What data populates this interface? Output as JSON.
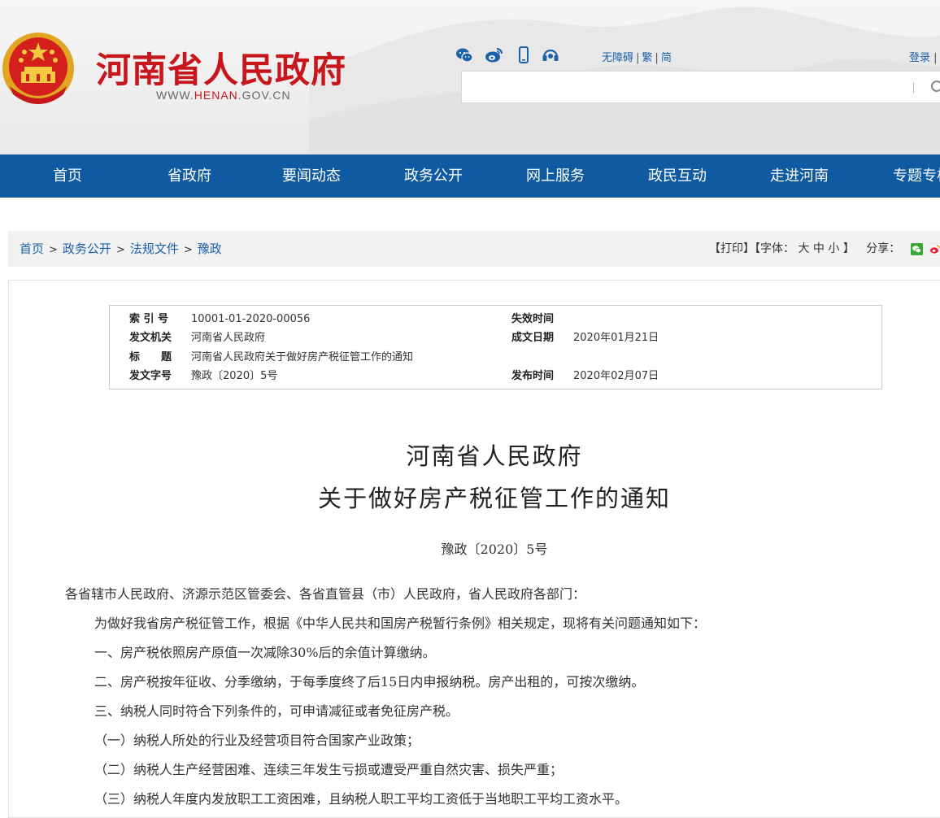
{
  "header": {
    "site_title": "河南省人民政府",
    "site_url_prefix": "WWW.",
    "site_url_highlight": "HENAN",
    "site_url_suffix": ".GOV.CN",
    "accessibility": "无障碍",
    "traditional": "繁",
    "simplified": "简",
    "login": "登录",
    "login_sep": "|",
    "search_placeholder": "",
    "icons": [
      "wechat-icon",
      "weibo-icon",
      "mobile-icon",
      "headset-icon"
    ],
    "brand_red": "#c8161d",
    "link_blue": "#1d61a8"
  },
  "nav": {
    "color": "#0f5aa0",
    "items": [
      "首页",
      "省政府",
      "要闻动态",
      "政务公开",
      "网上服务",
      "政民互动",
      "走进河南",
      "专题专栏"
    ]
  },
  "breadcrumb": {
    "items": [
      "首页",
      "政务公开",
      "法规文件",
      "豫政"
    ],
    "separator": ">"
  },
  "tools": {
    "print": "【打印】",
    "font_prefix": "【字体：",
    "font_large": "大",
    "font_medium": "中",
    "font_small": "小",
    "font_suffix": "】",
    "share_label": "分享："
  },
  "meta": {
    "index_label": "索 引 号",
    "index_value": "10001-01-2020-00056",
    "expire_label": "失效时间",
    "expire_value": "",
    "issuer_label": "发文机关",
    "issuer_value": "河南省人民政府",
    "created_label": "成文日期",
    "created_value": "2020年01月21日",
    "title_label": "标　　题",
    "title_value": "河南省人民政府关于做好房产税征管工作的通知",
    "docno_label": "发文字号",
    "docno_value": "豫政〔2020〕5号",
    "published_label": "发布时间",
    "published_value": "2020年02月07日"
  },
  "document": {
    "title_line1": "河南省人民政府",
    "title_line2": "关于做好房产税征管工作的通知",
    "doc_number": "豫政〔2020〕5号",
    "paragraphs": [
      "各省辖市人民政府、济源示范区管委会、各省直管县（市）人民政府，省人民政府各部门：",
      "为做好我省房产税征管工作，根据《中华人民共和国房产税暂行条例》相关规定，现将有关问题通知如下：",
      "一、房产税依照房产原值一次减除30%后的余值计算缴纳。",
      "二、房产税按年征收、分季缴纳，于每季度终了后15日内申报纳税。房产出租的，可按次缴纳。",
      "三、纳税人同时符合下列条件的，可申请减征或者免征房产税。",
      "（一）纳税人所处的行业及经营项目符合国家产业政策；",
      "（二）纳税人生产经营困难、连续三年发生亏损或遭受严重自然灾害、损失严重；",
      "（三）纳税人年度内发放职工工资困难，且纳税人职工平均工资低于当地职工平均工资水平。"
    ]
  }
}
